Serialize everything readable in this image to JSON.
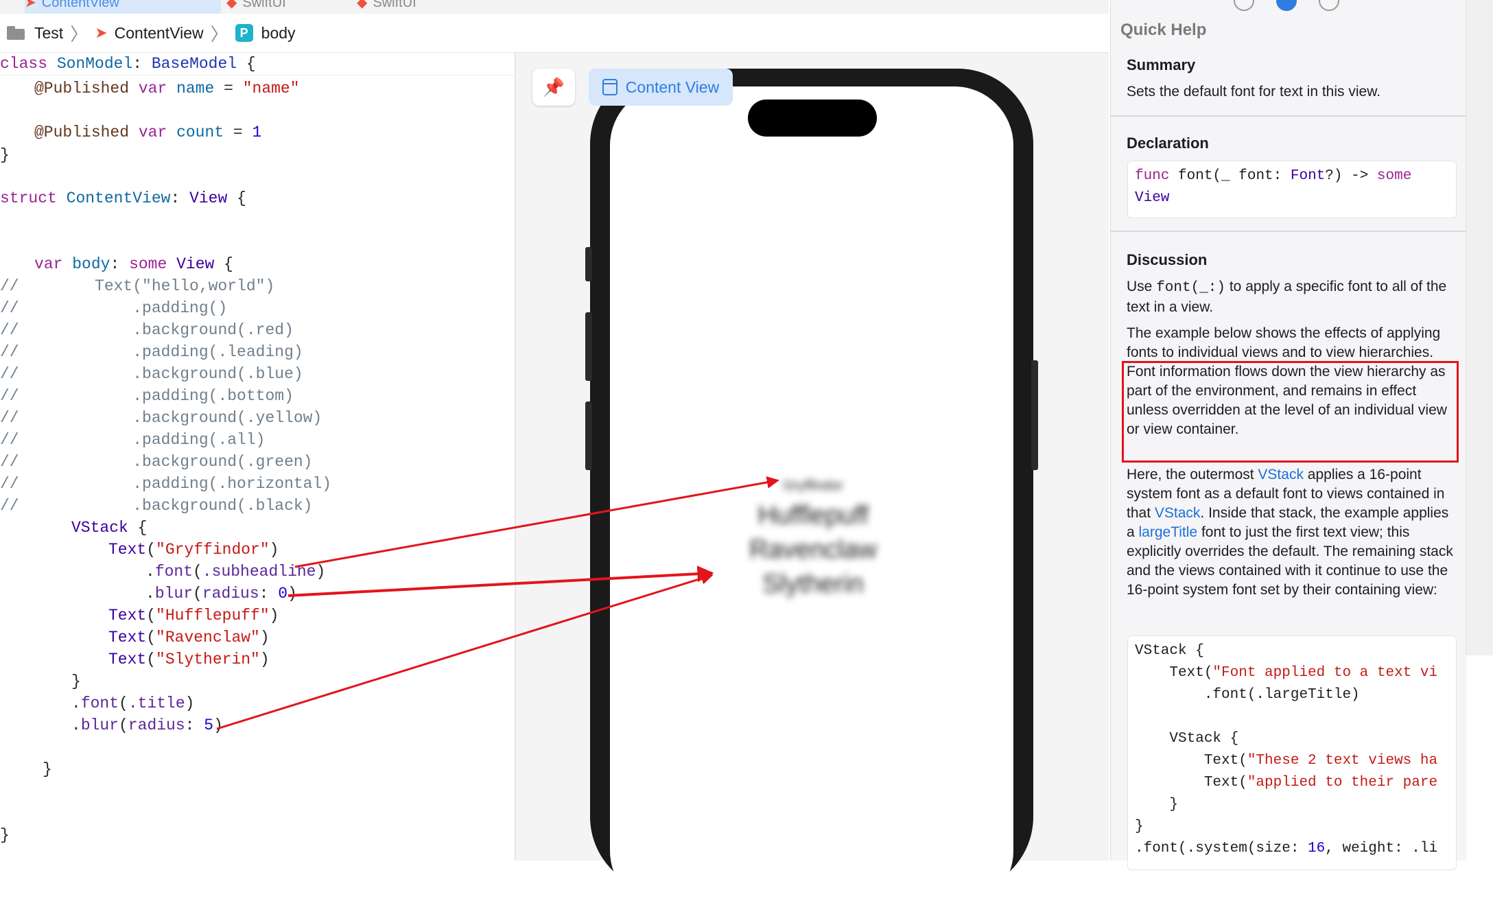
{
  "tabs": [
    {
      "label": "ContentView",
      "active": true
    },
    {
      "label": "SwiftUI",
      "active": false
    },
    {
      "label": "SwiftUI",
      "active": false
    }
  ],
  "breadcrumb": {
    "project": "Test",
    "file": "ContentView",
    "symbol_badge": "P",
    "symbol": "body"
  },
  "editor": {
    "sticky": "class SonModel: BaseModel {",
    "lines": {
      "l2_attr": "@Published",
      "l2_kw": "var",
      "l2_name": "name",
      "l2_op": " = ",
      "l2_str": "\"name\"",
      "l4_attr": "@Published",
      "l4_kw": "var",
      "l4_name": "count",
      "l4_op": " = ",
      "l4_num": "1",
      "l5": "}",
      "l7_kw": "struct",
      "l7_name": "ContentView",
      "l7_colon": ": ",
      "l7_type": "View",
      "l7_brace": " {",
      "l10_kw1": "var",
      "l10_name": "body",
      "l10_colon": ": ",
      "l10_kw2": "some",
      "l10_type": "View",
      "l10_brace": " {",
      "c1": "//        Text(\"hello,world\")",
      "c2": "//            .padding()",
      "c3": "//            .background(.red)",
      "c4": "//            .padding(.leading)",
      "c5": "//            .background(.blue)",
      "c6": "//            .padding(.bottom)",
      "c7": "//            .background(.yellow)",
      "c8": "//            .padding(.all)",
      "c9": "//            .background(.green)",
      "c10": "//            .padding(.horizontal)",
      "c11": "//            .background(.black)",
      "vstack": "VStack",
      "open_brace": " {",
      "text": "Text",
      "gryffindor": "\"Gryffindor\"",
      "font_sub_pre": ".",
      "font_sub_fn": "font",
      "font_sub_arg": ".subheadline",
      "blur0_fn": "blur",
      "blur0_label": "radius",
      "blur0_val": "0",
      "hufflepuff": "\"Hufflepuff\"",
      "ravenclaw": "\"Ravenclaw\"",
      "slytherin": "\"Slytherin\"",
      "close_brace": "}",
      "font_title_fn": "font",
      "font_title_arg": ".title",
      "blur5_fn": "blur",
      "blur5_label": "radius",
      "blur5_val": "5"
    }
  },
  "preview": {
    "content_view_label": "Content View",
    "blurred_texts": [
      "Gryffindor",
      "Hufflepuff",
      "Ravenclaw",
      "Slytherin"
    ]
  },
  "quick_help": {
    "title": "Quick Help",
    "summary_heading": "Summary",
    "summary": "Sets the default font for text in this view.",
    "declaration_heading": "Declaration",
    "decl_func": "func",
    "decl_sig": " font(_ font: ",
    "decl_font_type": "Font",
    "decl_rest": "?) -> ",
    "decl_some": "some",
    "decl_view": "View",
    "discussion_heading": "Discussion",
    "p1_a": "Use ",
    "p1_code": "font(_:)",
    "p1_b": " to apply a specific font to all of the text in a view.",
    "p2": "The example below shows the effects of applying fonts to individual views and to view hierarchies. Font information flows down the view hierarchy as part of the environment, and remains in effect unless overridden at the level of an individual view or view container.",
    "p3_a": "Here, the outermost ",
    "p3_link1": "VStack",
    "p3_b": " applies a 16-point system font as a default font to views contained in that ",
    "p3_link2": "VStack",
    "p3_c": ". Inside that stack, the example applies a ",
    "p3_link3": "largeTitle",
    "p3_d": " font to just the first text view; this explicitly overrides the default. The remaining stack and the views contained with it continue to use the 16-point system font set by their containing view:",
    "ex": {
      "l1": "VStack {",
      "l2_a": "    Text(",
      "l2_str": "\"Font applied to a text vi",
      "l3": "        .font(.largeTitle)",
      "l5": "    VStack {",
      "l6_a": "        Text(",
      "l6_str": "\"These 2 text views ha",
      "l7_a": "        Text(",
      "l7_str": "\"applied to their pare",
      "l8": "    }",
      "l9": "}",
      "l10_a": ".font(.system(size: ",
      "l10_num": "16",
      "l10_b": ", weight: .li"
    }
  },
  "colors": {
    "annotation": "#e3141c",
    "accent": "#2f7de1",
    "swift_orange": "#f05138"
  }
}
